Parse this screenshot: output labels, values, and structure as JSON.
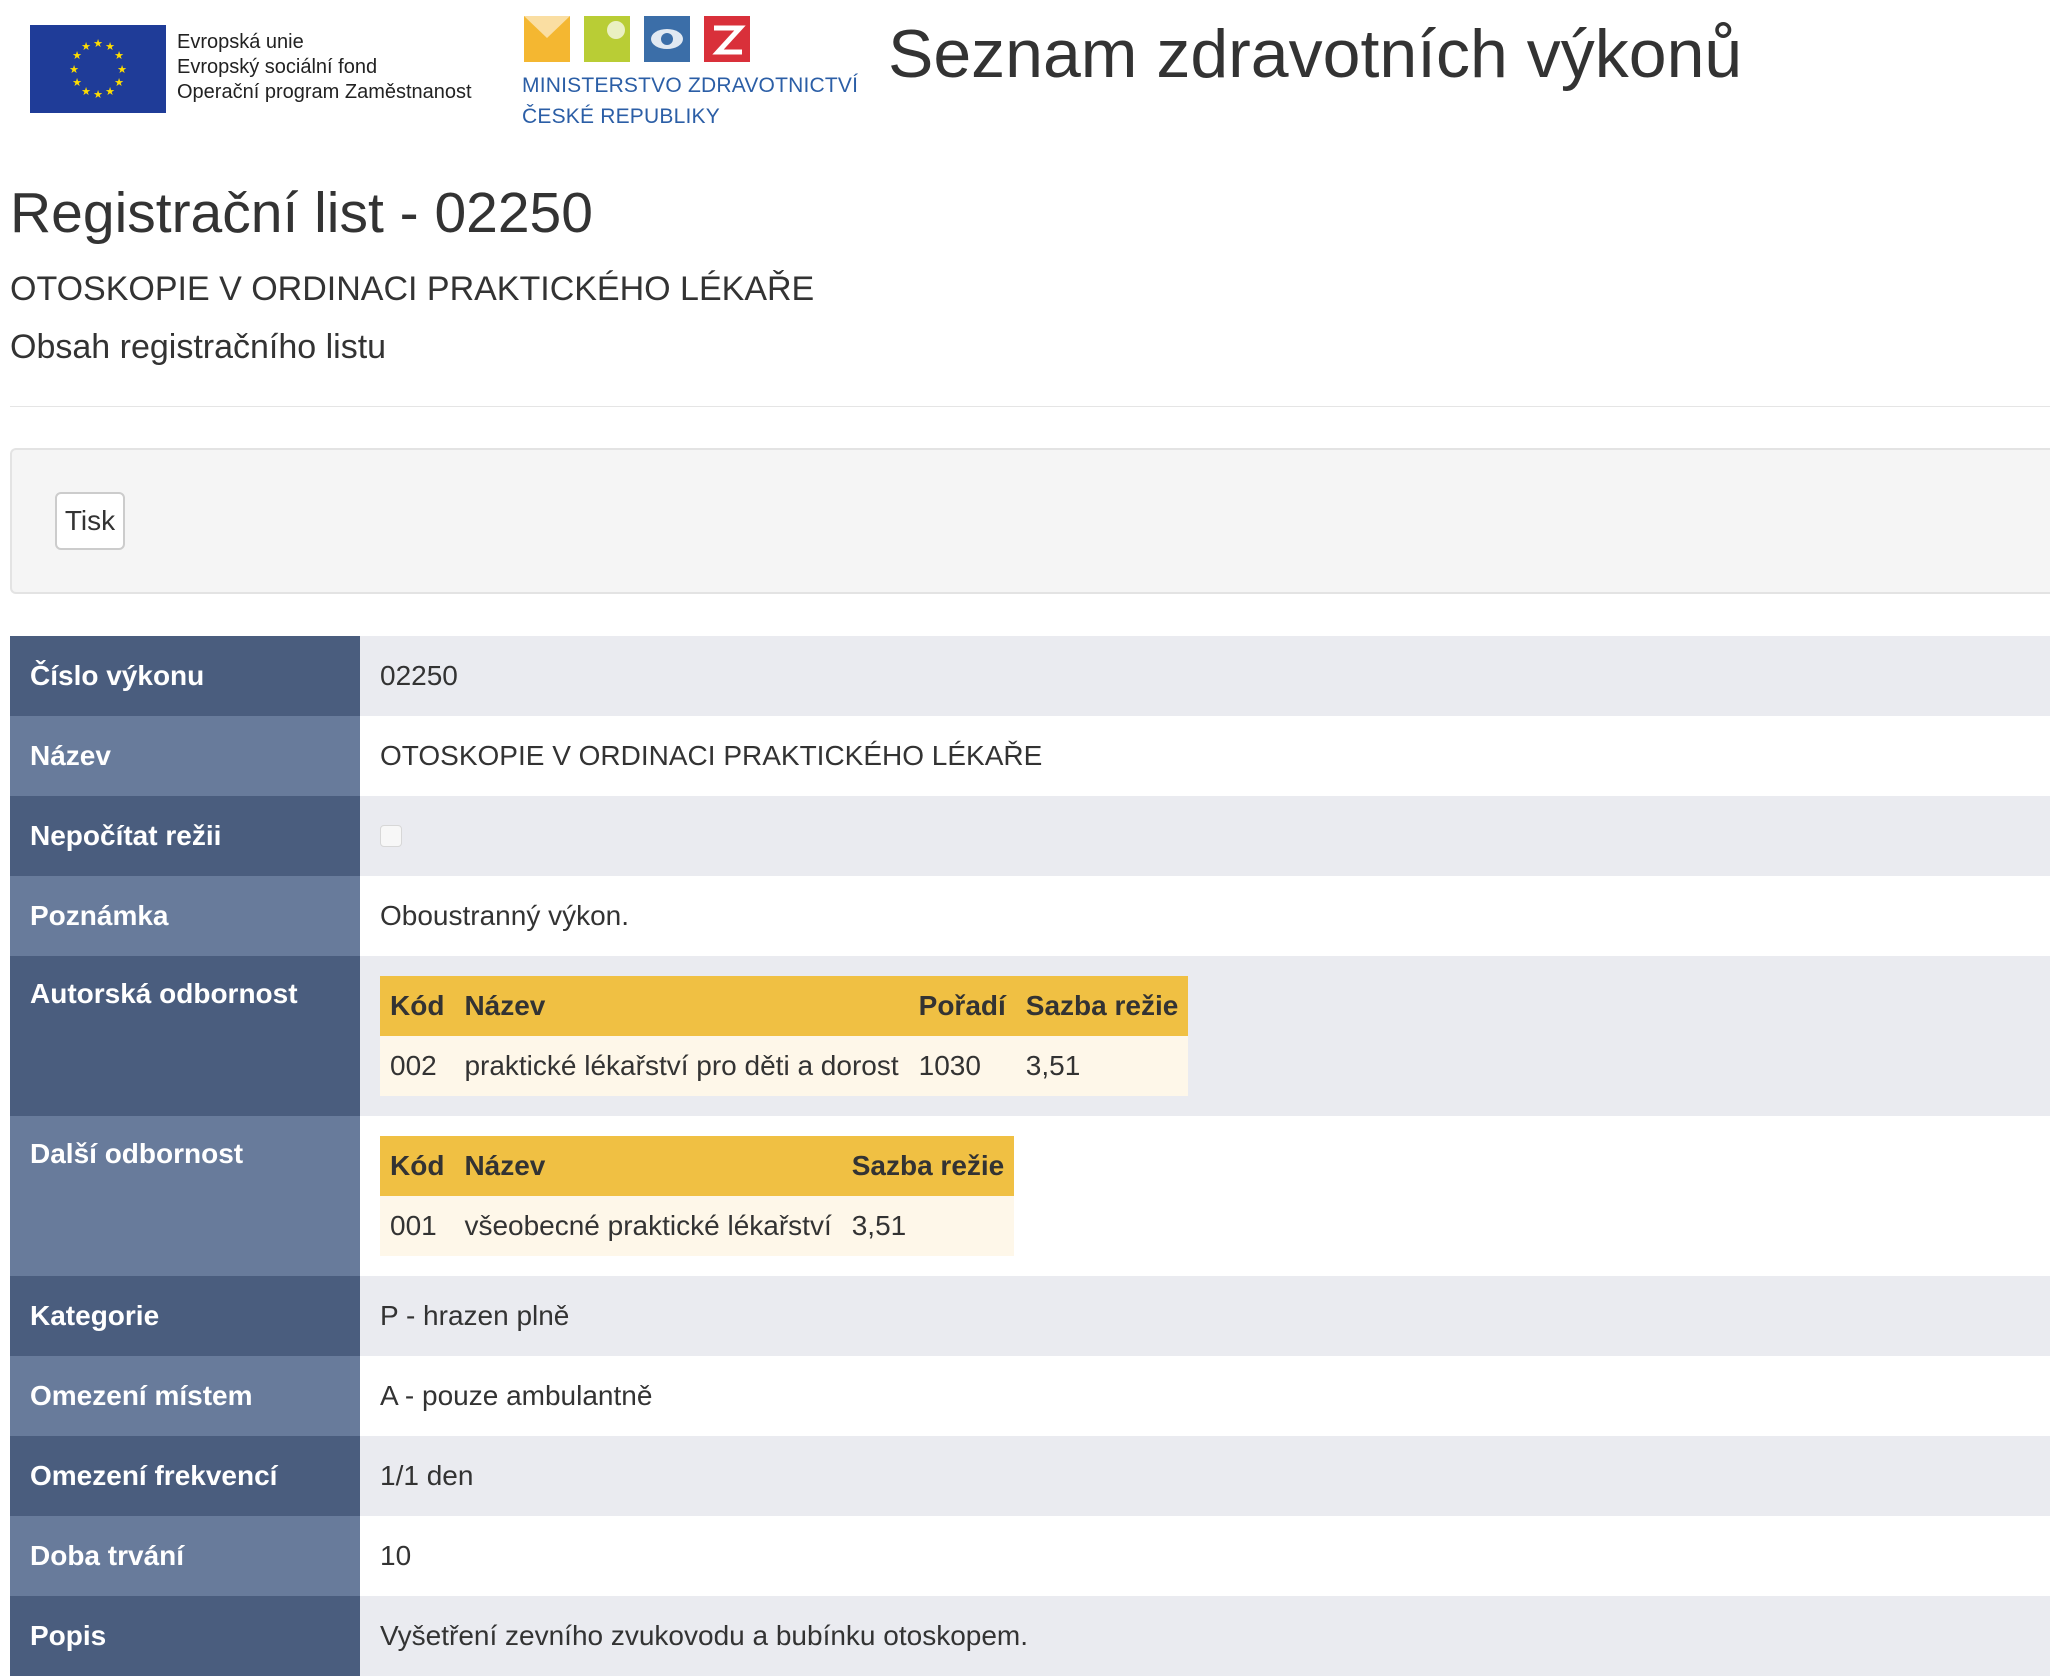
{
  "header": {
    "eu_logo_lines": [
      "Evropská unie",
      "Evropský sociální fond",
      "Operační program Zaměstnanost"
    ],
    "ministry_lines": [
      "MINISTERSTVO ZDRAVOTNICTVÍ",
      "ČESKÉ REPUBLIKY"
    ],
    "site_title": "Seznam zdravotních výkonů"
  },
  "page": {
    "title": "Registrační list - 02250",
    "subtitle": "OTOSKOPIE V ORDINACI PRAKTICKÉHO LÉKAŘE",
    "section_heading": "Obsah registračního listu"
  },
  "toolbar": {
    "print_label": "Tisk"
  },
  "detail": {
    "cislo_vykonu": {
      "label": "Číslo výkonu",
      "value": "02250"
    },
    "nazev": {
      "label": "Název",
      "value": "OTOSKOPIE V ORDINACI PRAKTICKÉHO LÉKAŘE"
    },
    "nepocitat_rezii": {
      "label": "Nepočítat režii",
      "checked": false
    },
    "poznamka": {
      "label": "Poznámka",
      "value": "Oboustranný výkon."
    },
    "autorska_odbornost": {
      "label": "Autorská odbornost",
      "headers": [
        "Kód",
        "Název",
        "Pořadí",
        "Sazba režie"
      ],
      "rows": [
        {
          "kod": "002",
          "nazev": "praktické lékařství pro děti a dorost",
          "poradi": "1030",
          "sazba": "3,51"
        }
      ]
    },
    "dalsi_odbornost": {
      "label": "Další odbornost",
      "headers": [
        "Kód",
        "Název",
        "Sazba režie"
      ],
      "rows": [
        {
          "kod": "001",
          "nazev": "všeobecné praktické lékařství",
          "sazba": "3,51"
        }
      ]
    },
    "kategorie": {
      "label": "Kategorie",
      "value": "P - hrazen plně"
    },
    "omezeni_mistem": {
      "label": "Omezení místem",
      "value": "A - pouze ambulantně"
    },
    "omezeni_frekvenci": {
      "label": "Omezení frekvencí",
      "value": "1/1 den"
    },
    "doba_trvani": {
      "label": "Doba trvání",
      "value": "10"
    },
    "popis": {
      "label": "Popis",
      "value": "Vyšetření zevního zvukovodu a bubínku otoskopem."
    }
  },
  "colors": {
    "label_dark": "#4a5d7e",
    "label_light": "#687b9b",
    "row_shaded": "#eaebf0",
    "inner_header": "#f0c043",
    "inner_row": "#fef7e9",
    "eu_flag": "#1f3c98",
    "eu_stars": "#ffdd00",
    "ministry_blue": "#2b5ea6"
  }
}
